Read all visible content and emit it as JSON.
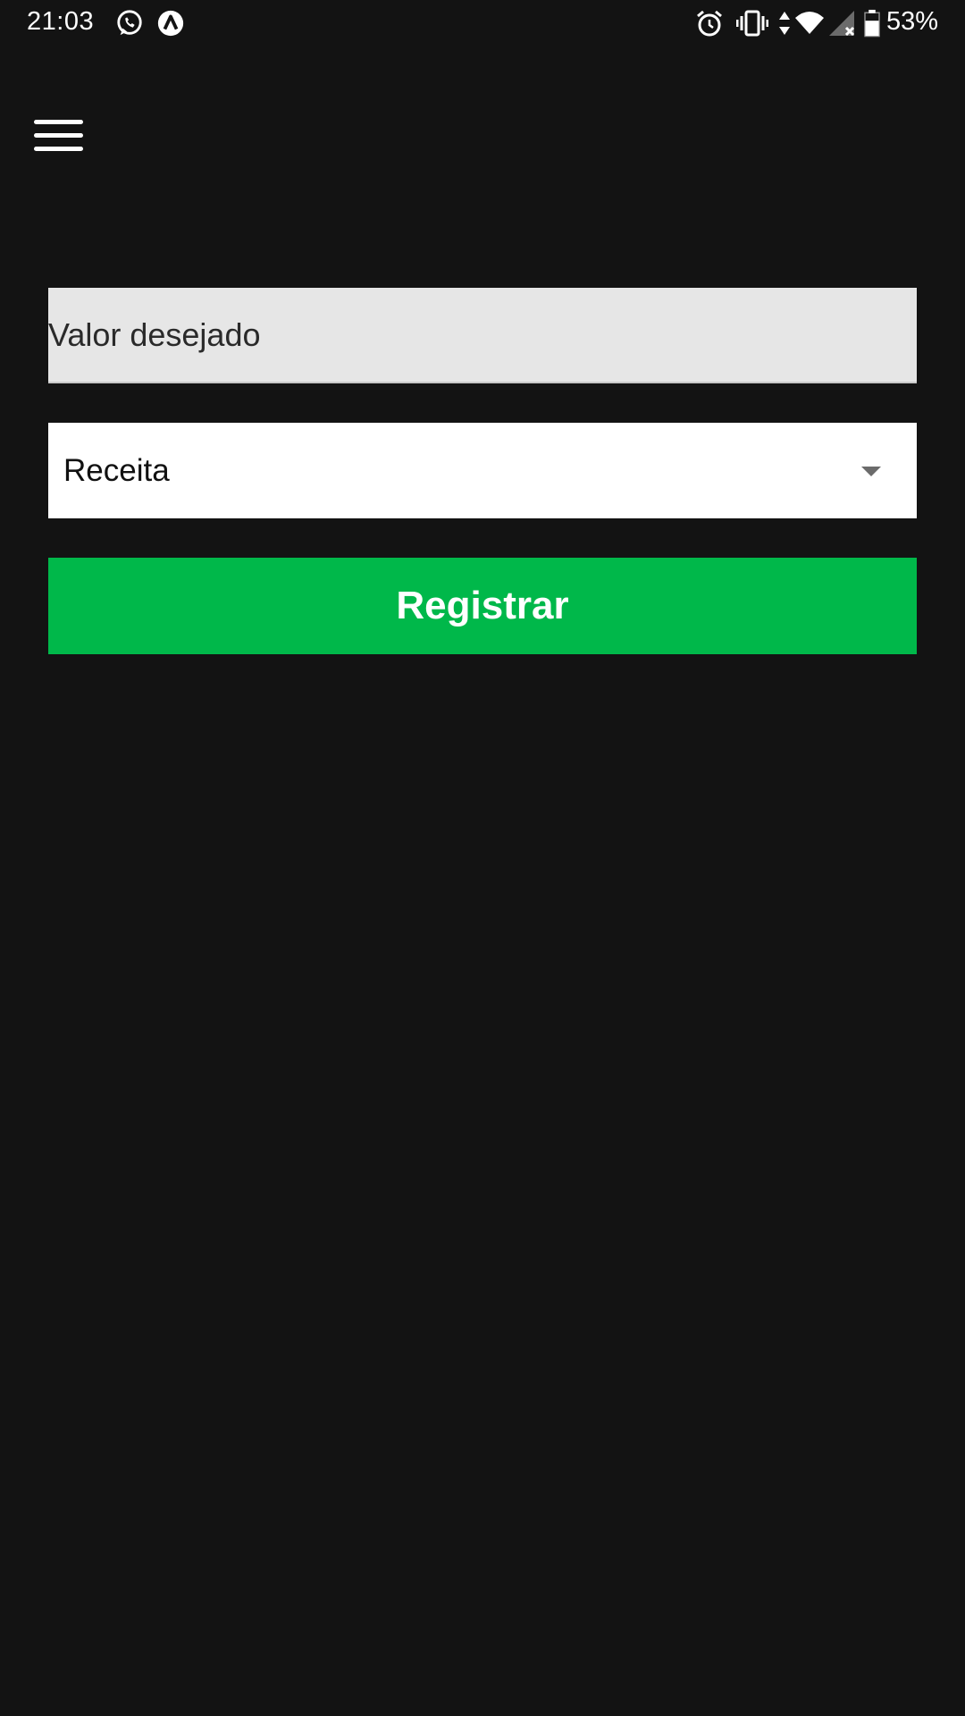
{
  "status_bar": {
    "time": "21:03",
    "battery_percent": "53%",
    "battery_level": 0.53,
    "notification_icons": [
      "whatsapp-icon",
      "navigation-app-icon"
    ],
    "system_icons": [
      "alarm-icon",
      "vibrate-icon",
      "data-arrows-icon",
      "wifi-icon",
      "no-signal-icon",
      "battery-icon"
    ]
  },
  "app_bar": {
    "menu_icon": "hamburger-menu-icon"
  },
  "form": {
    "amount_placeholder": "Valor desejado",
    "amount_value": "",
    "type_selected": "Receita",
    "register_label": "Registrar"
  },
  "colors": {
    "background": "#131313",
    "input_background": "#e6e6e6",
    "select_background": "#ffffff",
    "accent": "#00b84a"
  }
}
